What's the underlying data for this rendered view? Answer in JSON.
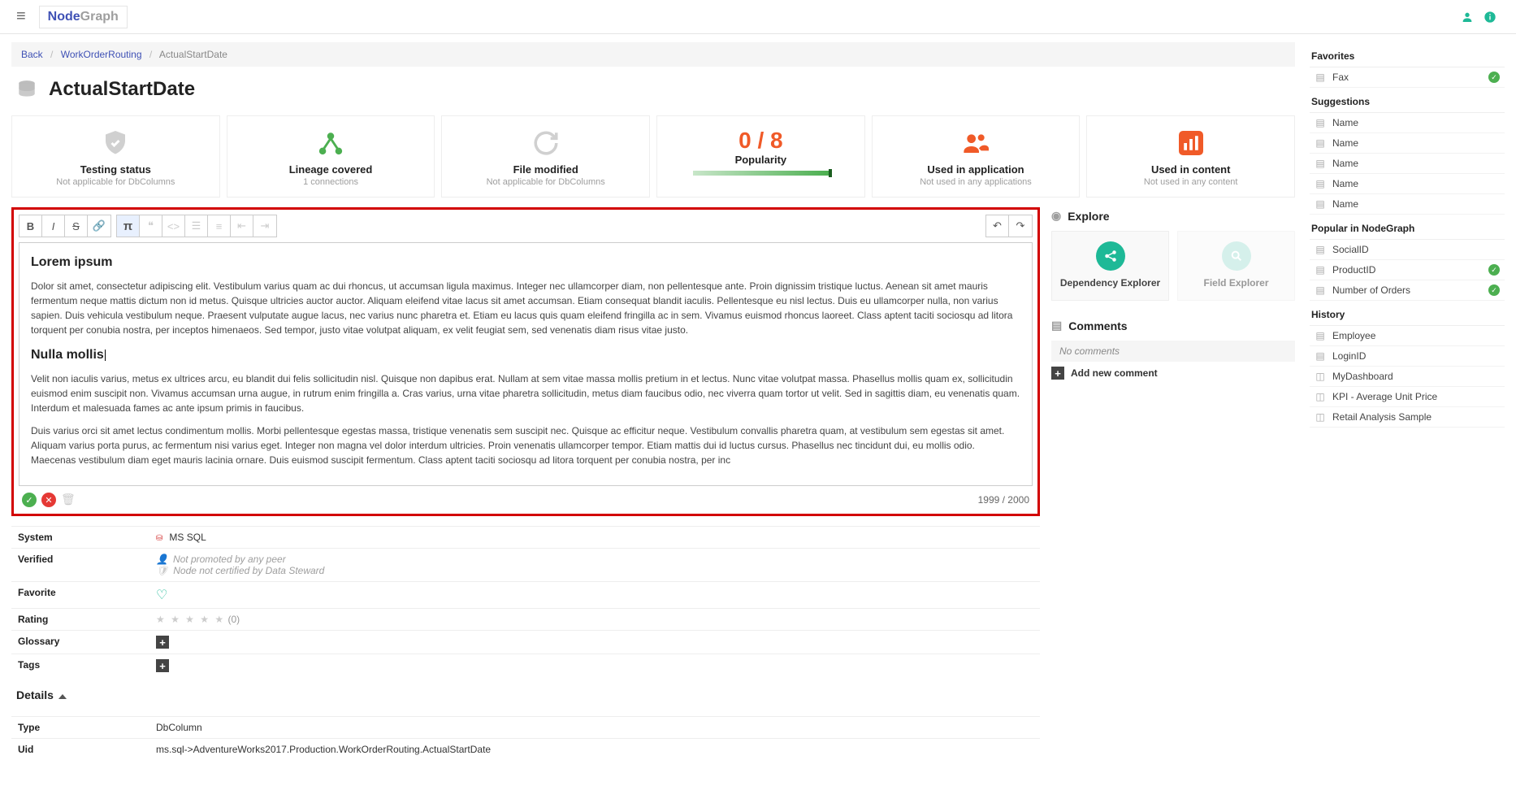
{
  "app": {
    "logo_a": "Node",
    "logo_b": "Graph"
  },
  "crumbs": {
    "back": "Back",
    "parent": "WorkOrderRouting",
    "current": "ActualStartDate"
  },
  "title": "ActualStartDate",
  "cards": [
    {
      "title": "Testing status",
      "sub": "Not applicable for DbColumns"
    },
    {
      "title": "Lineage covered",
      "sub": "1 connections"
    },
    {
      "title": "File modified",
      "sub": "Not applicable for DbColumns"
    },
    {
      "title": "Popularity",
      "sub": "",
      "pop": "0 / 8"
    },
    {
      "title": "Used in application",
      "sub": "Not used in any applications"
    },
    {
      "title": "Used in content",
      "sub": "Not used in any content"
    }
  ],
  "editor": {
    "h1": "Lorem ipsum",
    "p1": "Dolor sit amet, consectetur adipiscing elit. Vestibulum varius quam ac dui rhoncus, ut accumsan ligula maximus. Integer nec ullamcorper diam, non pellentesque ante. Proin dignissim tristique luctus. Aenean sit amet mauris fermentum neque mattis dictum non id metus. Quisque ultricies auctor auctor. Aliquam eleifend vitae lacus sit amet accumsan. Etiam consequat blandit iaculis. Pellentesque eu nisl lectus. Duis eu ullamcorper nulla, non varius sapien. Duis vehicula vestibulum neque. Praesent vulputate augue lacus, nec varius nunc pharetra et. Etiam eu lacus quis quam eleifend fringilla ac in sem. Vivamus euismod rhoncus laoreet. Class aptent taciti sociosqu ad litora torquent per conubia nostra, per inceptos himenaeos. Sed tempor, justo vitae volutpat aliquam, ex velit feugiat sem, sed venenatis diam risus vitae justo.",
    "h2": "Nulla mollis",
    "p2": "Velit non iaculis varius, metus ex ultrices arcu, eu blandit dui felis sollicitudin nisl. Quisque non dapibus erat. Nullam at sem vitae massa mollis pretium in et lectus. Nunc vitae volutpat massa. Phasellus mollis quam ex, sollicitudin euismod enim suscipit non. Vivamus accumsan urna augue, in rutrum enim fringilla a. Cras varius, urna vitae pharetra sollicitudin, metus diam faucibus odio, nec viverra quam tortor ut velit. Sed in sagittis diam, eu venenatis quam. Interdum et malesuada fames ac ante ipsum primis in faucibus.",
    "p3": "Duis varius orci sit amet lectus condimentum mollis. Morbi pellentesque egestas massa, tristique venenatis sem suscipit nec. Quisque ac efficitur neque. Vestibulum convallis pharetra quam, at vestibulum sem egestas sit amet. Aliquam varius porta purus, ac fermentum nisi varius eget. Integer non magna vel dolor interdum ultricies. Proin venenatis ullamcorper tempor. Etiam mattis dui id luctus cursus. Phasellus nec tincidunt dui, eu mollis odio. Maecenas vestibulum diam eget mauris lacinia ornare. Duis euismod suscipit fermentum. Class aptent taciti sociosqu ad litora torquent per conubia nostra, per inc",
    "counter": "1999 / 2000"
  },
  "meta": {
    "system_label": "System",
    "system_value": "MS SQL",
    "verified_label": "Verified",
    "verified_a": "Not promoted by any peer",
    "verified_b": "Node not certified by Data Steward",
    "favorite_label": "Favorite",
    "rating_label": "Rating",
    "rating_count": "(0)",
    "glossary_label": "Glossary",
    "tags_label": "Tags"
  },
  "details": {
    "head": "Details",
    "type_label": "Type",
    "type_value": "DbColumn",
    "uid_label": "Uid",
    "uid_value": "ms.sql->AdventureWorks2017.Production.WorkOrderRouting.ActualStartDate"
  },
  "explore": {
    "head": "Explore",
    "dep": "Dependency Explorer",
    "field": "Field Explorer"
  },
  "comments": {
    "head": "Comments",
    "empty": "No comments",
    "add": "Add new comment"
  },
  "side": {
    "favorites": "Favorites",
    "fav_items": [
      "Fax"
    ],
    "suggestions": "Suggestions",
    "sug_items": [
      "Name",
      "Name",
      "Name",
      "Name",
      "Name"
    ],
    "popular": "Popular in NodeGraph",
    "pop_items": [
      {
        "t": "SocialID",
        "c": false
      },
      {
        "t": "ProductID",
        "c": true
      },
      {
        "t": "Number of Orders",
        "c": true
      }
    ],
    "history": "History",
    "hist_items": [
      "Employee",
      "LoginID",
      "MyDashboard",
      "KPI - Average Unit Price",
      "Retail Analysis Sample"
    ]
  }
}
